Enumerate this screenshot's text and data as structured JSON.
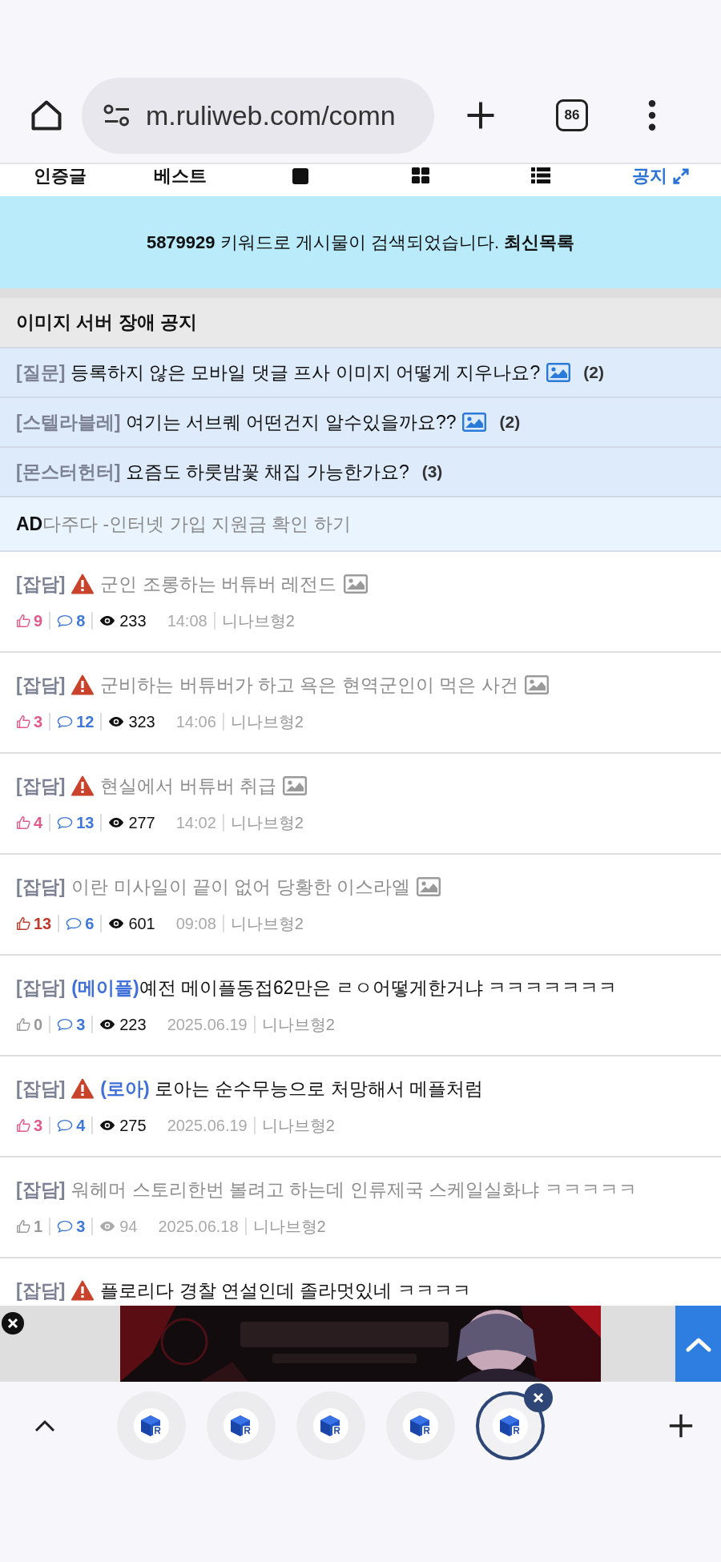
{
  "browser": {
    "url": "m.ruliweb.com/comn",
    "tab_count": "86"
  },
  "nav_tabs": [
    {
      "kind": "text",
      "label": "인증글"
    },
    {
      "kind": "text",
      "label": "베스트"
    },
    {
      "kind": "single"
    },
    {
      "kind": "grid"
    },
    {
      "kind": "list"
    },
    {
      "kind": "link",
      "label": "공지"
    }
  ],
  "search_banner": {
    "message": "**5879929** 키워드로 게시물이 검색되었습니다. **최신목록**"
  },
  "notice": {
    "title": "이미지 서버 장애 공지",
    "rows": [
      {
        "kind": "post",
        "tag": "[질문]",
        "title": "등록하지 않은 모바일 댓글 프사 이미지 어떻게 지우나요?",
        "has_image": true,
        "count": "(2)"
      },
      {
        "kind": "post",
        "tag": "[스텔라블레]",
        "title": "여기는 서브퀘 어떤건지 알수있을까요??",
        "has_image": true,
        "count": "(2)"
      },
      {
        "kind": "post",
        "tag": "[몬스터헌터]",
        "title": "요즘도 하룻밤꽃 채집 가능한가요?",
        "has_image": false,
        "count": "(3)"
      },
      {
        "kind": "ad",
        "tag": "AD",
        "title": "다주다 -인터넷 가입 지원금 확인 하기"
      }
    ]
  },
  "posts": [
    {
      "category": "[잡담]",
      "warning": true,
      "title": "군인 조롱하는 버튜버 레전드",
      "read": true,
      "has_image": true,
      "likes": "9",
      "color": "#e05a8a",
      "comments": "8",
      "views": "233",
      "views_muted": false,
      "time": "14:08",
      "author": "니나브형2"
    },
    {
      "category": "[잡담]",
      "warning": true,
      "title": "군비하는 버튜버가 하고 욕은 현역군인이 먹은 사건",
      "read": true,
      "has_image": true,
      "likes": "3",
      "color": "#e05a8a",
      "comments": "12",
      "views": "323",
      "views_muted": false,
      "time": "14:06",
      "author": "니나브형2"
    },
    {
      "category": "[잡담]",
      "warning": true,
      "title": "현실에서 버튜버 취급",
      "read": true,
      "has_image": true,
      "likes": "4",
      "color": "#e05a8a",
      "comments": "13",
      "views": "277",
      "views_muted": false,
      "time": "14:02",
      "author": "니나브형2"
    },
    {
      "category": "[잡담]",
      "warning": false,
      "title": "이란 미사일이 끝이 없어 당황한 이스라엘",
      "read": true,
      "has_image": true,
      "likes": "13",
      "color": "#c0392b",
      "comments": "6",
      "views": "601",
      "views_muted": false,
      "time": "09:08",
      "author": "니나브형2"
    },
    {
      "category": "[잡담]",
      "warning": false,
      "subject": "(메이플)",
      "title": "예전 메이플동접62만은 ㄹㅇ어떻게한거냐 ㅋㅋㅋㅋㅋㅋㅋ",
      "read": false,
      "has_image": false,
      "likes": "0",
      "color": "#999999",
      "comments": "3",
      "views": "223",
      "views_muted": false,
      "time": "2025.06.19",
      "author": "니나브형2"
    },
    {
      "category": "[잡담]",
      "warning": true,
      "subject": "(로아)",
      "title": "로아는 순수무능으로 처망해서 메플처럼",
      "read": false,
      "has_image": false,
      "likes": "3",
      "color": "#e05a8a",
      "comments": "4",
      "views": "275",
      "views_muted": false,
      "time": "2025.06.19",
      "author": "니나브형2"
    },
    {
      "category": "[잡담]",
      "warning": false,
      "title": "워헤머 스토리한번 볼려고 하는데 인류제국 스케일실화냐 ㅋㅋㅋㅋㅋ",
      "read": true,
      "has_image": false,
      "likes": "1",
      "color": "#999999",
      "comments": "3",
      "views": "94",
      "views_muted": true,
      "time": "2025.06.18",
      "author": "니나브형2"
    },
    {
      "category": "[잡담]",
      "warning": true,
      "title": "플로리다 경찰 연설인데 졸라멋있네 ㅋㅋㅋㅋ",
      "read": false,
      "has_image": false
    }
  ],
  "tab_strip": [
    {
      "selected": false
    },
    {
      "selected": false
    },
    {
      "selected": false
    },
    {
      "selected": false
    },
    {
      "selected": true
    }
  ]
}
